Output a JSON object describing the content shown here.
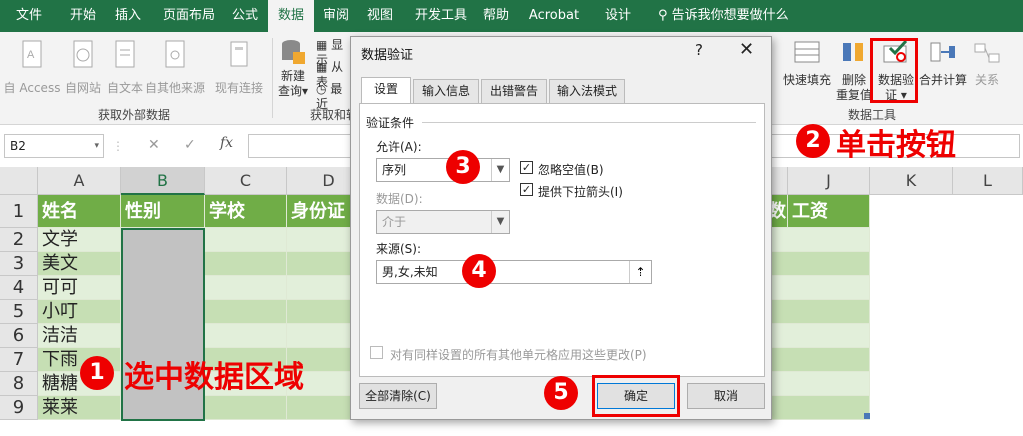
{
  "menubar": {
    "tabs": [
      "文件",
      "开始",
      "插入",
      "页面布局",
      "公式",
      "数据",
      "审阅",
      "视图",
      "开发工具",
      "帮助",
      "Acrobat",
      "设计"
    ],
    "active": "数据",
    "tell_me": "告诉我你想要做什么"
  },
  "ribbon": {
    "external": {
      "access": "自 Access",
      "web": "自网站",
      "text": "自文本",
      "other": "自其他来源",
      "existing": "现有连接",
      "group": "获取外部数据"
    },
    "transform": {
      "new_query": "新建",
      "new_query2": "查询",
      "dd": "▾",
      "show": "显示",
      "from": "从表",
      "recent": "最近",
      "group": "获取和转"
    },
    "tools": {
      "flash_fill": "快速填充",
      "remove_dup": "删除",
      "remove_dup2": "重复值",
      "validation": "数据验",
      "validation2": "证 ▾",
      "consolidate": "合并计算",
      "relations": "关系",
      "group": "数据工具"
    }
  },
  "formula_bar": {
    "name_box": "B2",
    "x": "✕",
    "check": "✓",
    "fx": "fx"
  },
  "sheet": {
    "columns": [
      "A",
      "B",
      "C",
      "D",
      "J",
      "K",
      "L"
    ],
    "rows": [
      "1",
      "2",
      "3",
      "4",
      "5",
      "6",
      "7",
      "8",
      "9"
    ],
    "headers": {
      "a": "姓名",
      "b": "性别",
      "c": "学校",
      "d": "身份证",
      "i": "数",
      "j": "工资"
    },
    "names": [
      "文学",
      "美文",
      "可可",
      "小叮",
      "洁洁",
      "下雨",
      "糖糖",
      "莱莱"
    ]
  },
  "dialog": {
    "title": "数据验证",
    "help": "?",
    "close": "✕",
    "tabs": [
      "设置",
      "输入信息",
      "出错警告",
      "输入法模式"
    ],
    "section": "验证条件",
    "allow_label": "允许(A):",
    "allow_value": "序列",
    "data_label": "数据(D):",
    "data_value": "介于",
    "ignore_blank": "忽略空值(B)",
    "dropdown": "提供下拉箭头(I)",
    "source_label": "来源(S):",
    "source_value": "男,女,未知",
    "apply_all": "对有同样设置的所有其他单元格应用这些更改(P)",
    "clear_all": "全部清除(C)",
    "ok": "确定",
    "cancel": "取消"
  },
  "annotations": {
    "step1": "选中数据区域",
    "step2": "单击按钮",
    "n1": "1",
    "n2": "2",
    "n3": "3",
    "n4": "4",
    "n5": "5"
  },
  "colors": {
    "excel_green": "#217346",
    "header_green": "#70ad47",
    "band_light": "#e2efda",
    "annotation_red": "#ee0000"
  }
}
